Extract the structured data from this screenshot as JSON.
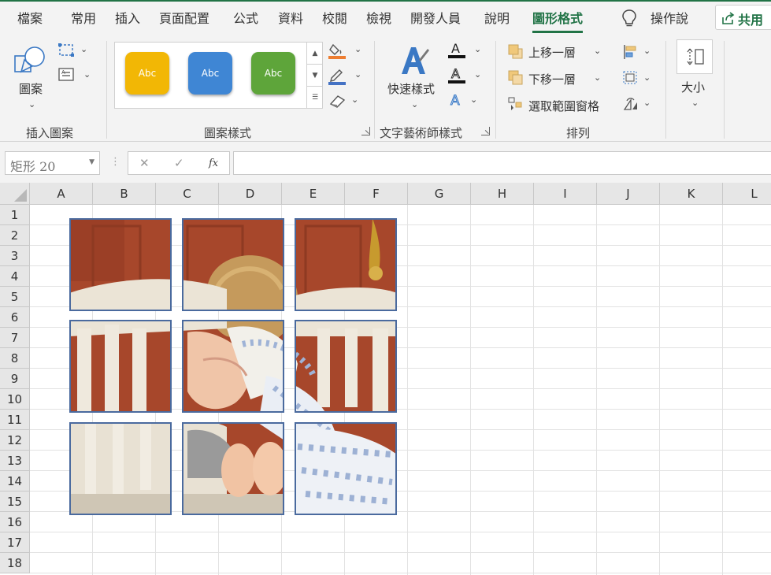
{
  "tabs": [
    {
      "label": "檔案"
    },
    {
      "label": "常用"
    },
    {
      "label": "插入"
    },
    {
      "label": "頁面配置"
    },
    {
      "label": "公式"
    },
    {
      "label": "資料"
    },
    {
      "label": "校閱"
    },
    {
      "label": "檢視"
    },
    {
      "label": "開發人員"
    },
    {
      "label": "說明"
    },
    {
      "label": "圖形格式",
      "active": true
    }
  ],
  "tell_me": "操作說",
  "share": "共用",
  "ribbon": {
    "insert_shapes": {
      "shapes_label": "圖案",
      "group_label": "插入圖案"
    },
    "shape_styles": {
      "presets": [
        {
          "text": "Abc",
          "color": "#f2b705"
        },
        {
          "text": "Abc",
          "color": "#3f86d4"
        },
        {
          "text": "Abc",
          "color": "#5ea53a"
        }
      ],
      "group_label": "圖案樣式"
    },
    "wordart": {
      "quick_styles_label": "快速樣式",
      "group_label": "文字藝術師樣式"
    },
    "arrange": {
      "bring_forward": "上移一層",
      "send_backward": "下移一層",
      "selection_pane": "選取範圍窗格",
      "group_label": "排列"
    },
    "size": {
      "label": "大小"
    }
  },
  "formula_bar": {
    "name_box": "矩形 20",
    "fx": "fx",
    "value": ""
  },
  "columns": [
    "A",
    "B",
    "C",
    "D",
    "E",
    "F",
    "G",
    "H",
    "I",
    "J",
    "K",
    "L"
  ],
  "rows": [
    "1",
    "2",
    "3",
    "4",
    "5",
    "6",
    "7",
    "8",
    "9",
    "10",
    "11",
    "12",
    "13",
    "14",
    "15",
    "16",
    "17",
    "18"
  ],
  "picture": {
    "description_name": "puzzle-photo-tiles",
    "tiles": 9,
    "border_color": "#4a6a9e"
  }
}
